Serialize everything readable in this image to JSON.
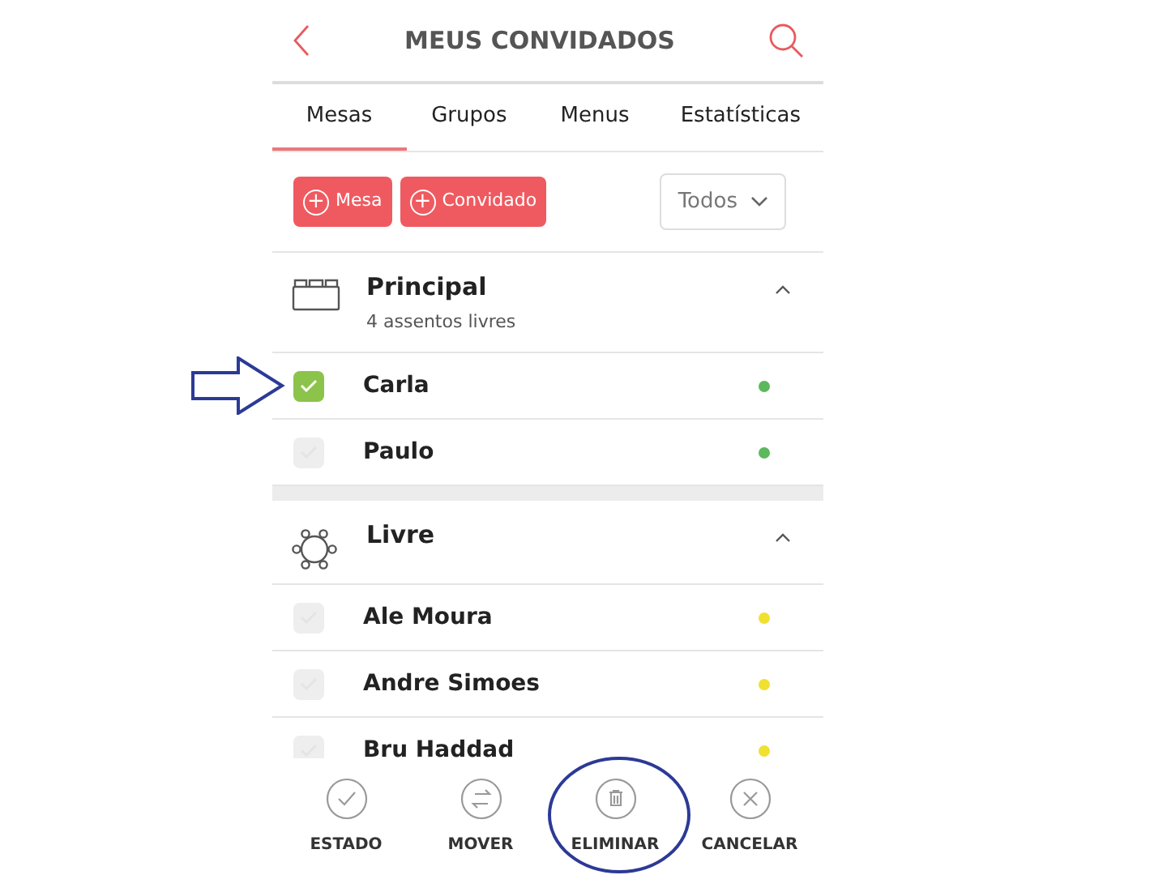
{
  "header": {
    "title": "MEUS CONVIDADOS"
  },
  "tabs": [
    {
      "label": "Mesas",
      "selected": true
    },
    {
      "label": "Grupos",
      "selected": false
    },
    {
      "label": "Menus",
      "selected": false
    },
    {
      "label": "Estatísticas",
      "selected": false
    }
  ],
  "add_buttons": [
    {
      "plus": "+",
      "label": "Mesa"
    },
    {
      "plus": "+",
      "label": "Convidado"
    }
  ],
  "filter": {
    "value": "Todos"
  },
  "groups": [
    {
      "name": "Principal",
      "kind": "rect-table",
      "subtitle": "4 assentos livres",
      "expanded": true,
      "guests": [
        {
          "name": "Carla",
          "checked": true,
          "color": "#5cb85c"
        },
        {
          "name": "Paulo",
          "checked": false,
          "color": "#5cb85c"
        }
      ]
    },
    {
      "name": "Livre",
      "kind": "round-table",
      "expanded": true,
      "guests": [
        {
          "name": "Ale Moura",
          "checked": false,
          "color": "#f0e030"
        },
        {
          "name": "Andre Simoes",
          "checked": false,
          "color": "#f0e030"
        },
        {
          "name": "Bru Haddad",
          "checked": false,
          "color": "#f0e030"
        }
      ]
    }
  ],
  "actions": [
    {
      "label": "ESTADO",
      "kind": "check"
    },
    {
      "label": "MOVER",
      "kind": "swap"
    },
    {
      "label": "ELIMINAR",
      "kind": "trash"
    },
    {
      "label": "CANCELAR",
      "kind": "cancel"
    }
  ]
}
